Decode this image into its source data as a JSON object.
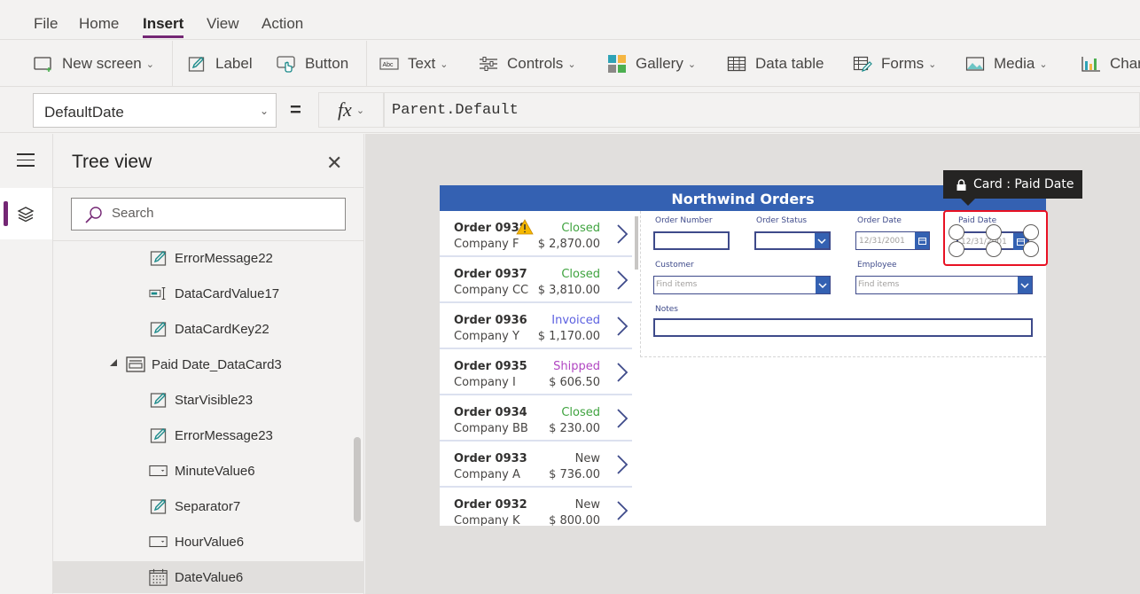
{
  "menu": {
    "items": [
      {
        "label": "File"
      },
      {
        "label": "Home"
      },
      {
        "label": "Insert",
        "active": true
      },
      {
        "label": "View"
      },
      {
        "label": "Action"
      }
    ]
  },
  "ribbon": {
    "new_screen": "New screen",
    "label": "Label",
    "button": "Button",
    "text": "Text",
    "controls": "Controls",
    "gallery": "Gallery",
    "data_table": "Data table",
    "forms": "Forms",
    "media": "Media",
    "charts": "Charts"
  },
  "formula_bar": {
    "property": "DefaultDate",
    "equals": "=",
    "fx": "fx",
    "formula": "Parent.Default"
  },
  "tree_view": {
    "title": "Tree view",
    "search_placeholder": "Search",
    "items": [
      {
        "label": "ErrorMessage22",
        "icon": "label-icon",
        "indent": 1
      },
      {
        "label": "DataCardValue17",
        "icon": "text-input-icon",
        "indent": 1
      },
      {
        "label": "DataCardKey22",
        "icon": "label-icon",
        "indent": 1
      },
      {
        "label": "Paid Date_DataCard3",
        "icon": "card-icon",
        "indent": 0,
        "expanded": true
      },
      {
        "label": "StarVisible23",
        "icon": "label-icon",
        "indent": 1
      },
      {
        "label": "ErrorMessage23",
        "icon": "label-icon",
        "indent": 1
      },
      {
        "label": "MinuteValue6",
        "icon": "dropdown-icon",
        "indent": 1
      },
      {
        "label": "Separator7",
        "icon": "label-icon",
        "indent": 1
      },
      {
        "label": "HourValue6",
        "icon": "dropdown-icon",
        "indent": 1
      },
      {
        "label": "DateValue6",
        "icon": "calendar-icon",
        "indent": 1,
        "selected": true
      }
    ]
  },
  "app": {
    "title": "Northwind Orders",
    "orders": [
      {
        "number": "Order 0938",
        "company": "Company F",
        "status": "Closed",
        "amount": "$ 2,870.00",
        "status_color": "#3fa33f",
        "warning": true
      },
      {
        "number": "Order 0937",
        "company": "Company CC",
        "status": "Closed",
        "amount": "$ 3,810.00",
        "status_color": "#3fa33f"
      },
      {
        "number": "Order 0936",
        "company": "Company Y",
        "status": "Invoiced",
        "amount": "$ 1,170.00",
        "status_color": "#5b5fe0"
      },
      {
        "number": "Order 0935",
        "company": "Company I",
        "status": "Shipped",
        "amount": "$ 606.50",
        "status_color": "#b146c2"
      },
      {
        "number": "Order 0934",
        "company": "Company BB",
        "status": "Closed",
        "amount": "$ 230.00",
        "status_color": "#3fa33f"
      },
      {
        "number": "Order 0933",
        "company": "Company A",
        "status": "New",
        "amount": "$ 736.00",
        "status_color": "#484644"
      },
      {
        "number": "Order 0932",
        "company": "Company K",
        "status": "New",
        "amount": "$ 800.00",
        "status_color": "#484644"
      }
    ],
    "form": {
      "order_number_label": "Order Number",
      "order_status_label": "Order Status",
      "order_date_label": "Order Date",
      "order_date_value": "12/31/2001",
      "paid_date_label": "Paid Date",
      "paid_date_value": "12/31/2001",
      "customer_label": "Customer",
      "customer_placeholder": "Find items",
      "employee_label": "Employee",
      "employee_placeholder": "Find items",
      "notes_label": "Notes"
    },
    "tooltip": "Card : Paid Date"
  },
  "colors": {
    "accent": "#742774",
    "app_header": "#3461b2",
    "selection": "#e81123"
  }
}
